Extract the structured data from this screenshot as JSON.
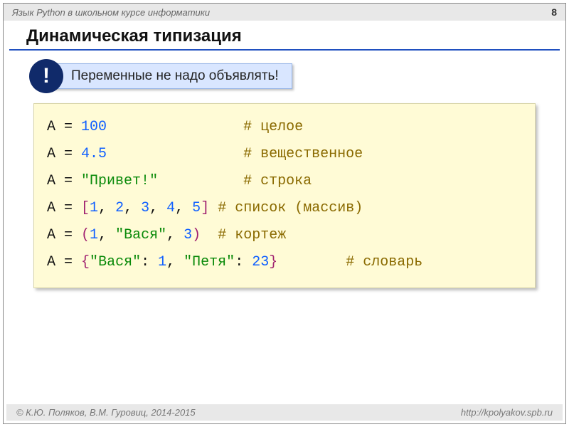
{
  "header": {
    "course": "Язык Python в школьном курсе информатики",
    "page": "8"
  },
  "title": "Динамическая типизация",
  "callout": {
    "bang": "!",
    "text": "Переменные не надо объявлять!"
  },
  "code": {
    "A": "A",
    "eq": " = ",
    "sp_after_100": "                ",
    "sp_after_45": "                ",
    "sp_after_str": "          ",
    "sp_after_list": " ",
    "sp_after_tuple": "  ",
    "sp_after_dict": "        ",
    "val_100": "100",
    "val_45": "4.5",
    "lq": "\"",
    "rq": "\"",
    "txt_privet": "Привет!",
    "lb": "[",
    "rb": "]",
    "lp": "(",
    "rp": ")",
    "lc": "{",
    "rc": "}",
    "n1": "1",
    "n2": "2",
    "n3": "3",
    "n4": "4",
    "n5": "5",
    "n23": "23",
    "comma": ", ",
    "colon": ": ",
    "vasya": "Вася",
    "petya": "Петя",
    "cmt_int": "# целое",
    "cmt_float": "# вещественное",
    "cmt_str": "# строка",
    "cmt_list": "# список (массив)",
    "cmt_tuple": "# кортеж",
    "cmt_dict": "# словарь"
  },
  "footer": {
    "left": "© К.Ю. Поляков, В.М. Гуровиц, 2014-2015",
    "right": "http://kpolyakov.spb.ru"
  }
}
